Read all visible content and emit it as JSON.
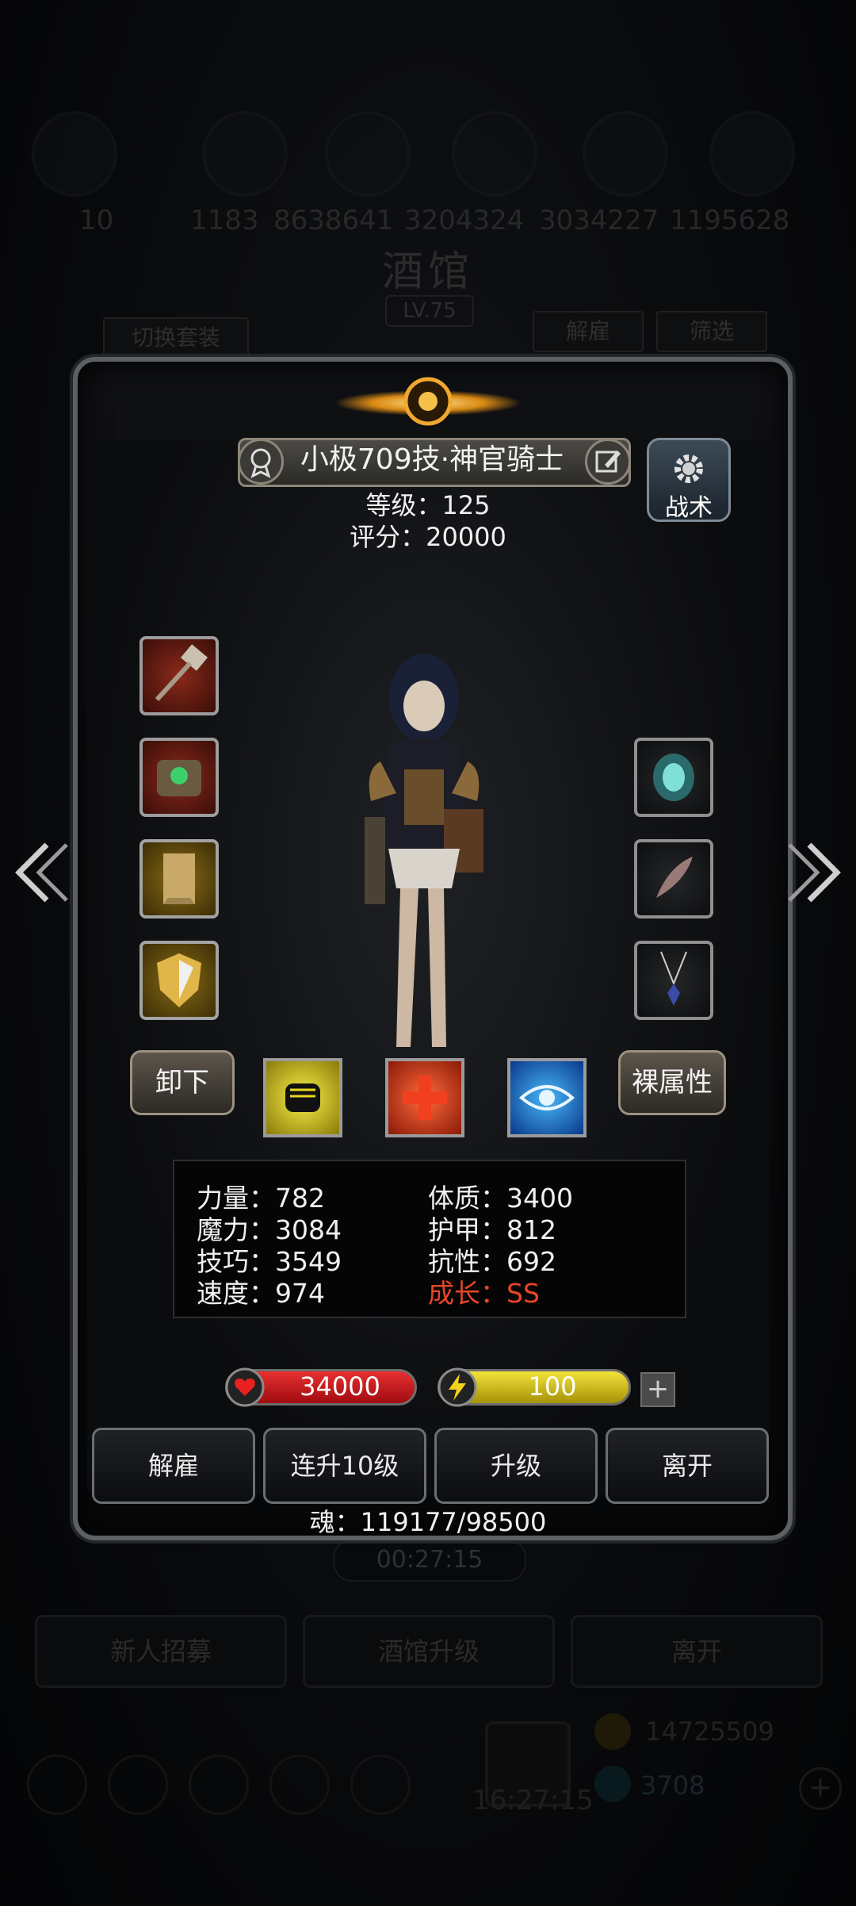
{
  "background": {
    "resource_values": [
      "10",
      "1183",
      "8638641",
      "3204324",
      "3034227",
      "1195628"
    ],
    "tavern_title": "酒馆",
    "tavern_level": "LV.75",
    "switch_outfit_label": "切换套装",
    "dismiss_label": "解雇",
    "filter_label": "筛选",
    "timer": "00:27:15",
    "recruit_label": "新人招募",
    "upgrade_tavern_label": "酒馆升级",
    "leave_label": "离开",
    "gold_amount": "14725509",
    "gem_amount": "3708",
    "bottom_timer": "16:27:15"
  },
  "hero": {
    "name": "小极709技·神官骑士",
    "level_text": "等级：125",
    "score_text": "评分：20000",
    "tactic_label": "战术"
  },
  "actions": {
    "unequip_label": "卸下",
    "base_attr_label": "裸属性"
  },
  "attributes": {
    "strength": "力量：782",
    "magic": "魔力：3084",
    "skill": "技巧：3549",
    "speed": "速度：974",
    "constitution": "体质：3400",
    "armor": "护甲：812",
    "resistance": "抗性：692",
    "growth": "成长：SS"
  },
  "bars": {
    "hp": "34000",
    "energy": "100"
  },
  "buttons": {
    "dismiss": "解雇",
    "level_up_10": "连升10级",
    "level_up": "升级",
    "leave": "离开"
  },
  "soul_text": "魂：119177/98500",
  "colors": {
    "growth": "#e8452a",
    "hp_bar": "#c8141a",
    "energy_bar": "#d6c41a"
  }
}
